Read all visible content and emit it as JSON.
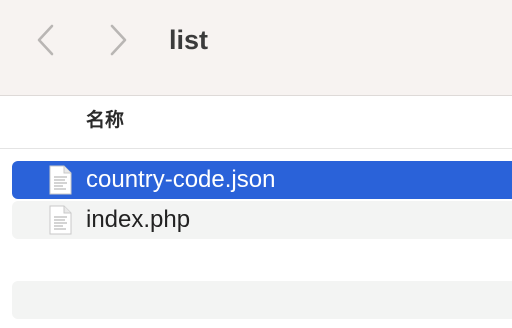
{
  "window": {
    "title": "list",
    "back_icon": "chevron-left-icon",
    "forward_icon": "chevron-right-icon"
  },
  "columns": {
    "name_label": "名称"
  },
  "files": [
    {
      "name": "country-code.json",
      "icon": "document-icon",
      "selected": true
    },
    {
      "name": "index.php",
      "icon": "document-icon",
      "selected": false
    }
  ],
  "colors": {
    "selection": "#2a62d9",
    "toolbar_bg": "#f7f3f1",
    "stripe": "#f3f4f3"
  }
}
